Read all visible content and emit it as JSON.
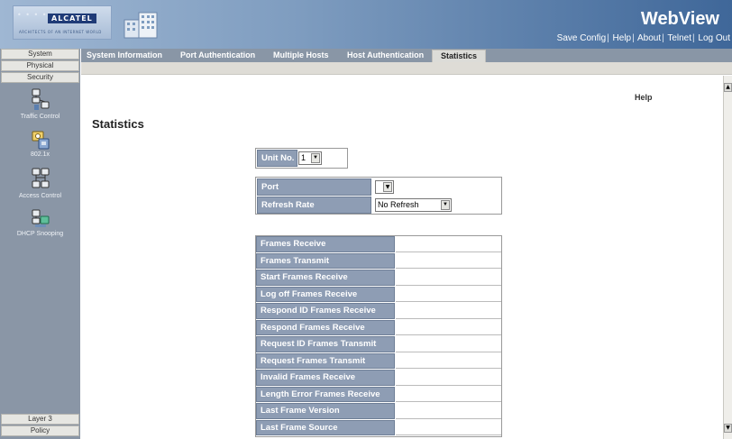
{
  "header": {
    "brand": "ALCATEL",
    "tagline": "ARCHITECTS OF AN INTERNET WORLD",
    "title": "WebView",
    "links": [
      "Save Config",
      "Help",
      "About",
      "Telnet",
      "Log Out"
    ]
  },
  "leftnav": {
    "top_buttons": [
      "System",
      "Physical",
      "Security"
    ],
    "icon_items": [
      {
        "label": "Traffic Control",
        "icon": "traffic-control-icon"
      },
      {
        "label": "802.1x",
        "icon": "dot1x-icon"
      },
      {
        "label": "Access Control",
        "icon": "access-control-icon"
      },
      {
        "label": "DHCP Snooping",
        "icon": "dhcp-snooping-icon"
      }
    ],
    "bottom_buttons": [
      "Layer 3",
      "Policy"
    ]
  },
  "tabs": [
    {
      "label": "System Information",
      "active": false
    },
    {
      "label": "Port Authentication",
      "active": false
    },
    {
      "label": "Multiple Hosts",
      "active": false
    },
    {
      "label": "Host Authentication",
      "active": false
    },
    {
      "label": "Statistics",
      "active": true
    }
  ],
  "main": {
    "help": "Help",
    "title": "Statistics",
    "unit": {
      "label": "Unit No.",
      "value": "1"
    },
    "port": {
      "label": "Port",
      "value": ""
    },
    "refresh": {
      "label": "Refresh Rate",
      "value": "No Refresh"
    },
    "stats": [
      {
        "label": "Frames Receive",
        "value": ""
      },
      {
        "label": "Frames Transmit",
        "value": ""
      },
      {
        "label": "Start Frames Receive",
        "value": ""
      },
      {
        "label": "Log off Frames Receive",
        "value": ""
      },
      {
        "label": "Respond ID Frames Receive",
        "value": ""
      },
      {
        "label": "Respond Frames Receive",
        "value": ""
      },
      {
        "label": "Request ID Frames Transmit",
        "value": ""
      },
      {
        "label": "Request Frames Transmit",
        "value": ""
      },
      {
        "label": "Invalid Frames Receive",
        "value": ""
      },
      {
        "label": "Length Error Frames Receive",
        "value": ""
      },
      {
        "label": "Last Frame Version",
        "value": ""
      },
      {
        "label": "Last Frame Source",
        "value": ""
      }
    ]
  },
  "colors": {
    "nav_bg": "#8a96a6",
    "label_bg": "#8e9db4",
    "header_gradient_end": "#3f6799"
  }
}
